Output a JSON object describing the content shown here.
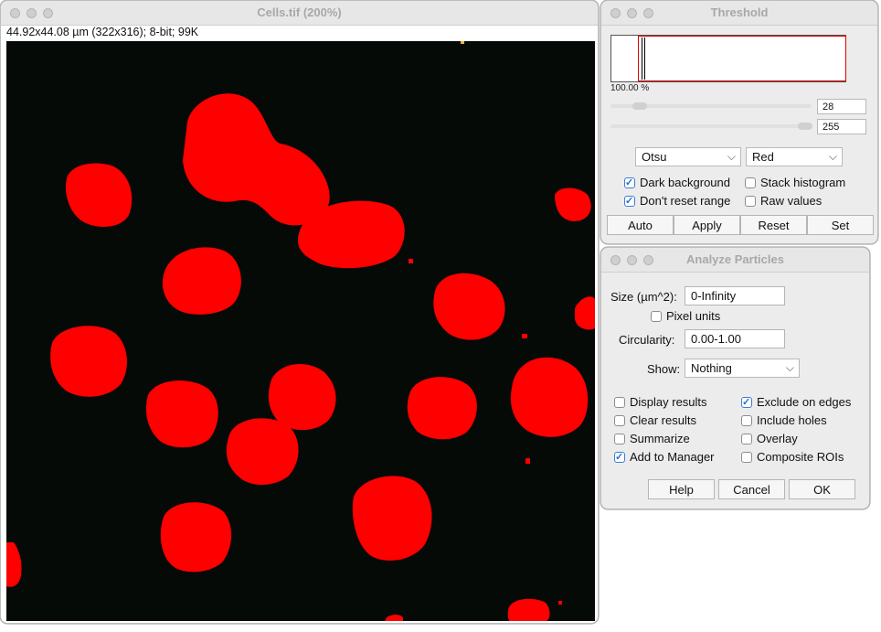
{
  "image_window": {
    "title": "Cells.tif (200%)",
    "info": "44.92x44.08 µm (322x316); 8-bit; 99K",
    "overlay_color": "#ff0000",
    "background_color": "#060a06"
  },
  "threshold": {
    "title": "Threshold",
    "percent": "100.00 %",
    "min_value": "28",
    "max_value": "255",
    "method": "Otsu",
    "display_mode": "Red",
    "checkboxes": {
      "dark_background": {
        "label": "Dark background",
        "checked": true
      },
      "stack_histogram": {
        "label": "Stack histogram",
        "checked": false
      },
      "dont_reset_range": {
        "label": "Don't reset range",
        "checked": true
      },
      "raw_values": {
        "label": "Raw values",
        "checked": false
      }
    },
    "buttons": {
      "auto": "Auto",
      "apply": "Apply",
      "reset": "Reset",
      "set": "Set"
    }
  },
  "analyze": {
    "title": "Analyze Particles",
    "size_label": "Size (µm^2):",
    "size_value": "0-Infinity",
    "pixel_units": {
      "label": "Pixel units",
      "checked": false
    },
    "circularity_label": "Circularity:",
    "circularity_value": "0.00-1.00",
    "show_label": "Show:",
    "show_value": "Nothing",
    "checkboxes": {
      "display_results": {
        "label": "Display results",
        "checked": false
      },
      "exclude_on_edges": {
        "label": "Exclude on edges",
        "checked": true
      },
      "clear_results": {
        "label": "Clear results",
        "checked": false
      },
      "include_holes": {
        "label": "Include holes",
        "checked": false
      },
      "summarize": {
        "label": "Summarize",
        "checked": false
      },
      "overlay": {
        "label": "Overlay",
        "checked": false
      },
      "add_to_manager": {
        "label": "Add to Manager",
        "checked": true
      },
      "composite_rois": {
        "label": "Composite ROIs",
        "checked": false
      }
    },
    "buttons": {
      "help": "Help",
      "cancel": "Cancel",
      "ok": "OK"
    }
  }
}
